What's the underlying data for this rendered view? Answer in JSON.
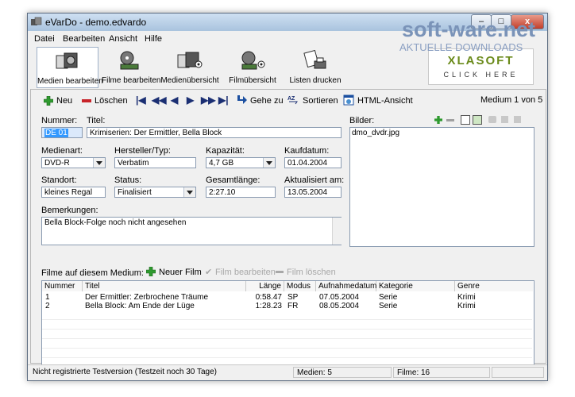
{
  "window": {
    "title": "eVarDo - demo.edvardo",
    "minimize": "–",
    "maximize": "□",
    "close": "x"
  },
  "watermark": {
    "brand": "soft-ware.net",
    "tagline": "AKTUELLE DOWNLOADS"
  },
  "menu": [
    "Datei",
    "Bearbeiten",
    "Ansicht",
    "Hilfe"
  ],
  "toolbar": [
    {
      "label": "Medien bearbeiten",
      "icon": "media-stack-icon"
    },
    {
      "label": "Filme bearbeiten",
      "icon": "film-reel-icon"
    },
    {
      "label": "Medienübersicht",
      "icon": "media-overview-icon"
    },
    {
      "label": "Filmübersicht",
      "icon": "film-overview-icon"
    },
    {
      "label": "Listen drucken",
      "icon": "print-list-icon"
    }
  ],
  "logo": {
    "text": "XLASOFT",
    "sub": "CLICK HERE"
  },
  "actions": {
    "new": "Neu",
    "delete": "Löschen",
    "goto": "Gehe zu",
    "sort": "Sortieren",
    "html_view": "HTML-Ansicht",
    "record_info": "Medium 1 von 5"
  },
  "nav": {
    "first": "|◀",
    "prev_fast": "◀◀",
    "prev": "◀",
    "next": "▶",
    "next_fast": "▶▶",
    "last": "▶|"
  },
  "form": {
    "number_label": "Nummer:",
    "number_value": "DE 01",
    "title_label": "Titel:",
    "title_value": "Krimiserien: Der Ermittler, Bella Block",
    "media_type_label": "Medienart:",
    "media_type_value": "DVD-R",
    "manufacturer_label": "Hersteller/Typ:",
    "manufacturer_value": "Verbatim",
    "capacity_label": "Kapazität:",
    "capacity_value": "4,7 GB",
    "purchase_label": "Kaufdatum:",
    "purchase_value": "01.04.2004",
    "location_label": "Standort:",
    "location_value": "kleines Regal",
    "status_label": "Status:",
    "status_value": "Finalisiert",
    "total_length_label": "Gesamtlänge:",
    "total_length_value": "2:27.10",
    "updated_label": "Aktualisiert am:",
    "updated_value": "13.05.2004",
    "remarks_label": "Bemerkungen:",
    "remarks_value": "Bella Block-Folge noch nicht angesehen"
  },
  "images": {
    "label": "Bilder:",
    "items": [
      "dmo_dvdr.jpg"
    ]
  },
  "films": {
    "label": "Filme auf diesem Medium:",
    "new_film": "Neuer Film",
    "edit_film": "Film bearbeiten",
    "delete_film": "Film löschen",
    "columns": [
      "Nummer",
      "Titel",
      "Länge",
      "Modus",
      "Aufnahmedatum",
      "Kategorie",
      "Genre"
    ],
    "rows": [
      [
        "1",
        "Der Ermittler: Zerbrochene Träume",
        "0:58.47",
        "SP",
        "07.05.2004",
        "Serie",
        "Krimi"
      ],
      [
        "2",
        "Bella Block: Am Ende der Lüge",
        "1:28.23",
        "FR",
        "08.05.2004",
        "Serie",
        "Krimi"
      ]
    ]
  },
  "status": {
    "trial": "Nicht registrierte Testversion (Testzeit noch 30 Tage)",
    "media": "Medien: 5",
    "films": "Filme: 16"
  },
  "colors": {
    "accent_green": "#2f9a2f",
    "delete_red": "#c8242a",
    "nav_blue": "#1b2f73",
    "selection": "#3399ff",
    "watermark": "#7a93b8"
  }
}
